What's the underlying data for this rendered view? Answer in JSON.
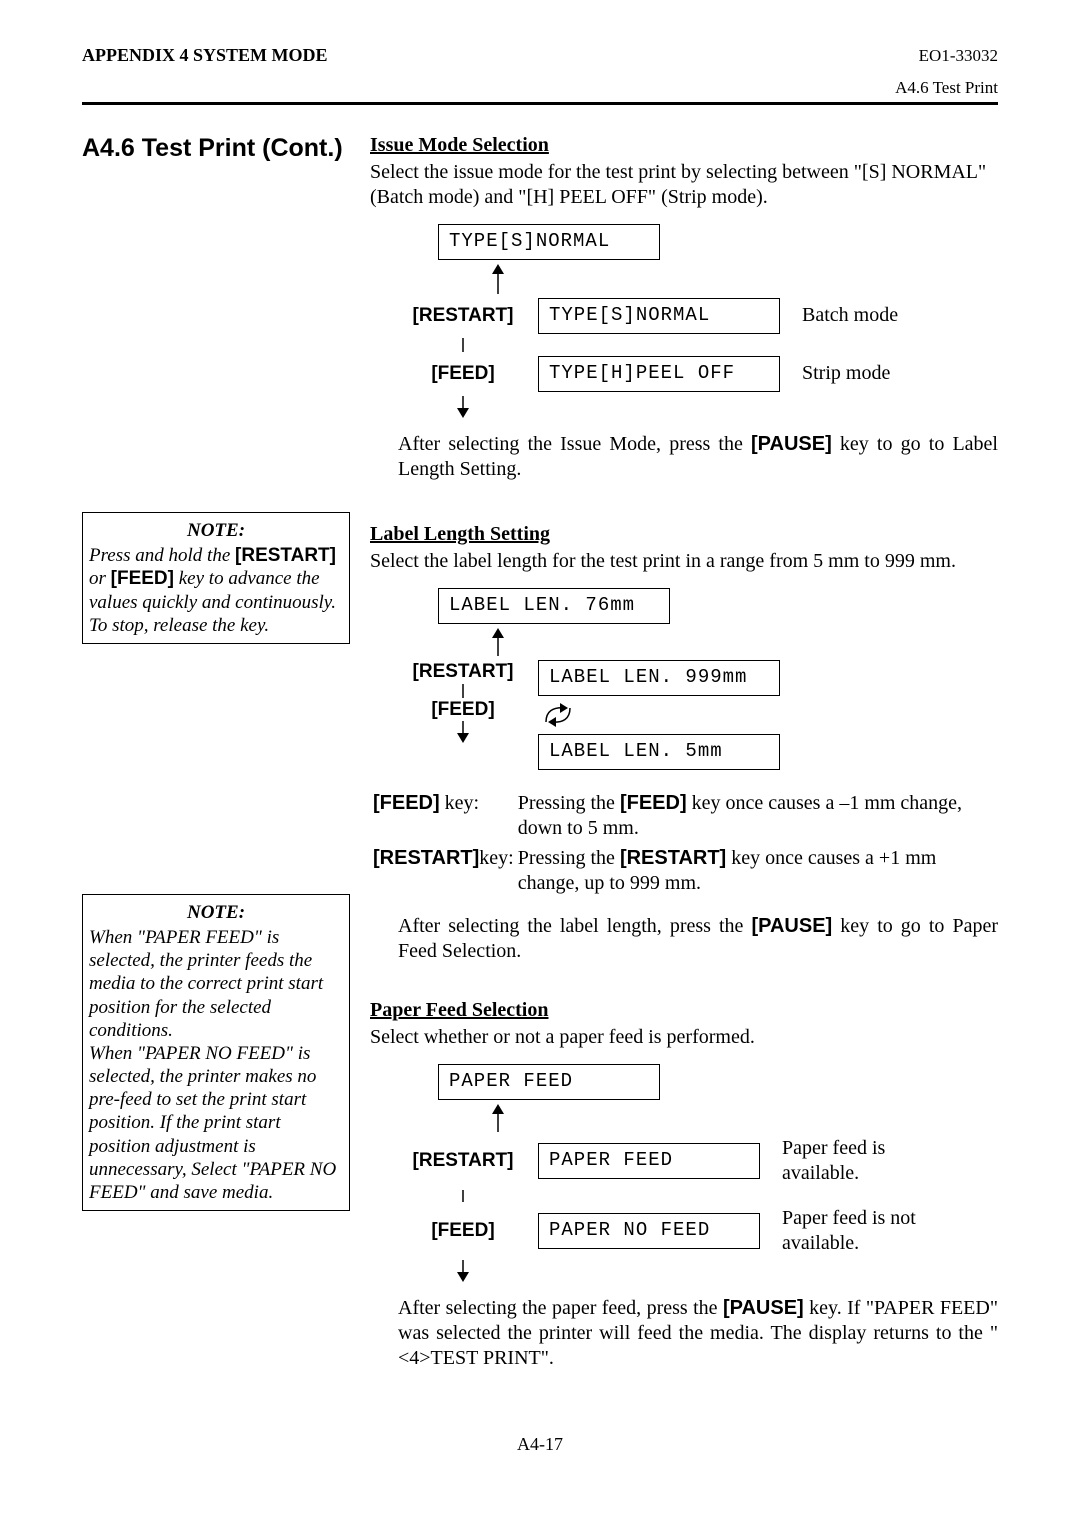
{
  "header": {
    "appendix": "APPENDIX 4 SYSTEM MODE",
    "doc_id": "EO1-33032",
    "section_ref": "A4.6 Test Print"
  },
  "title": "A4.6  Test Print  (Cont.)",
  "issue": {
    "heading": "Issue Mode Selection",
    "intro": "Select the issue mode for the test print by selecting between \"[S] NORMAL\" (Batch mode) and \"[H] PEEL OFF\" (Strip mode).",
    "lcd_top": "TYPE[S]NORMAL",
    "restart": "[RESTART]",
    "feed": "[FEED]",
    "opt1_lcd": "TYPE[S]NORMAL",
    "opt1_desc": "Batch mode",
    "opt2_lcd": "TYPE[H]PEEL OFF",
    "opt2_desc": "Strip mode",
    "after_a": "After selecting the Issue Mode, press the ",
    "pause_key": "[PAUSE]",
    "after_b": " key to go to Label Length Setting."
  },
  "note1": {
    "title": "NOTE:",
    "t1": "Press and hold the ",
    "b1": "[RESTART]",
    "t2": " or ",
    "b2": "[FEED]",
    "t3": " key to advance the values quickly and continuously.  To stop, release the key."
  },
  "label": {
    "heading": "Label Length Setting",
    "intro": "Select the label length for the test print in a range from 5 mm to 999 mm.",
    "lcd_top": "LABEL LEN.  76mm",
    "restart": "[RESTART]",
    "feed": "[FEED]",
    "lcd_max": "LABEL LEN. 999mm",
    "lcd_min": "LABEL LEN.   5mm",
    "feed_key": "[FEED]",
    "feed_key_suffix": " key:",
    "feed_key_desc_a": "Pressing the ",
    "feed_key_bold": "[FEED]",
    "feed_key_desc_b": " key once causes a –1 mm change, down to 5 mm.",
    "restart_key": "[RESTART]",
    "restart_key_suffix": "key:",
    "restart_key_desc_a": "Pressing the ",
    "restart_key_bold": "[RESTART]",
    "restart_key_desc_b": " key once causes a +1 mm change, up to 999 mm.",
    "after_a": "After selecting the label length, press the ",
    "pause_key": "[PAUSE]",
    "after_b": " key to go to Paper Feed Selection."
  },
  "note2": {
    "title": "NOTE:",
    "text": "When \"PAPER FEED\" is selected, the printer feeds the media to the correct print start position for the selected conditions.\nWhen \"PAPER NO FEED\" is selected, the printer makes no pre-feed to set the print start position.  If the print start position adjustment is unnecessary, Select \"PAPER NO FEED\" and save media."
  },
  "paper": {
    "heading": "Paper Feed Selection",
    "intro": "Select whether or not a paper feed is performed.",
    "lcd_top": "PAPER FEED",
    "restart": "[RESTART]",
    "feed": "[FEED]",
    "opt1_lcd": "PAPER FEED",
    "opt1_desc": "Paper feed is available.",
    "opt2_lcd": "PAPER NO FEED",
    "opt2_desc": "Paper feed is not available.",
    "after_a": "After selecting the paper feed, press the ",
    "pause_key": "[PAUSE]",
    "after_b": " key.  If \"PAPER FEED\" was selected the printer will feed the media.  The display returns to the \"<4>TEST PRINT\"."
  },
  "page_num": "A4-17"
}
